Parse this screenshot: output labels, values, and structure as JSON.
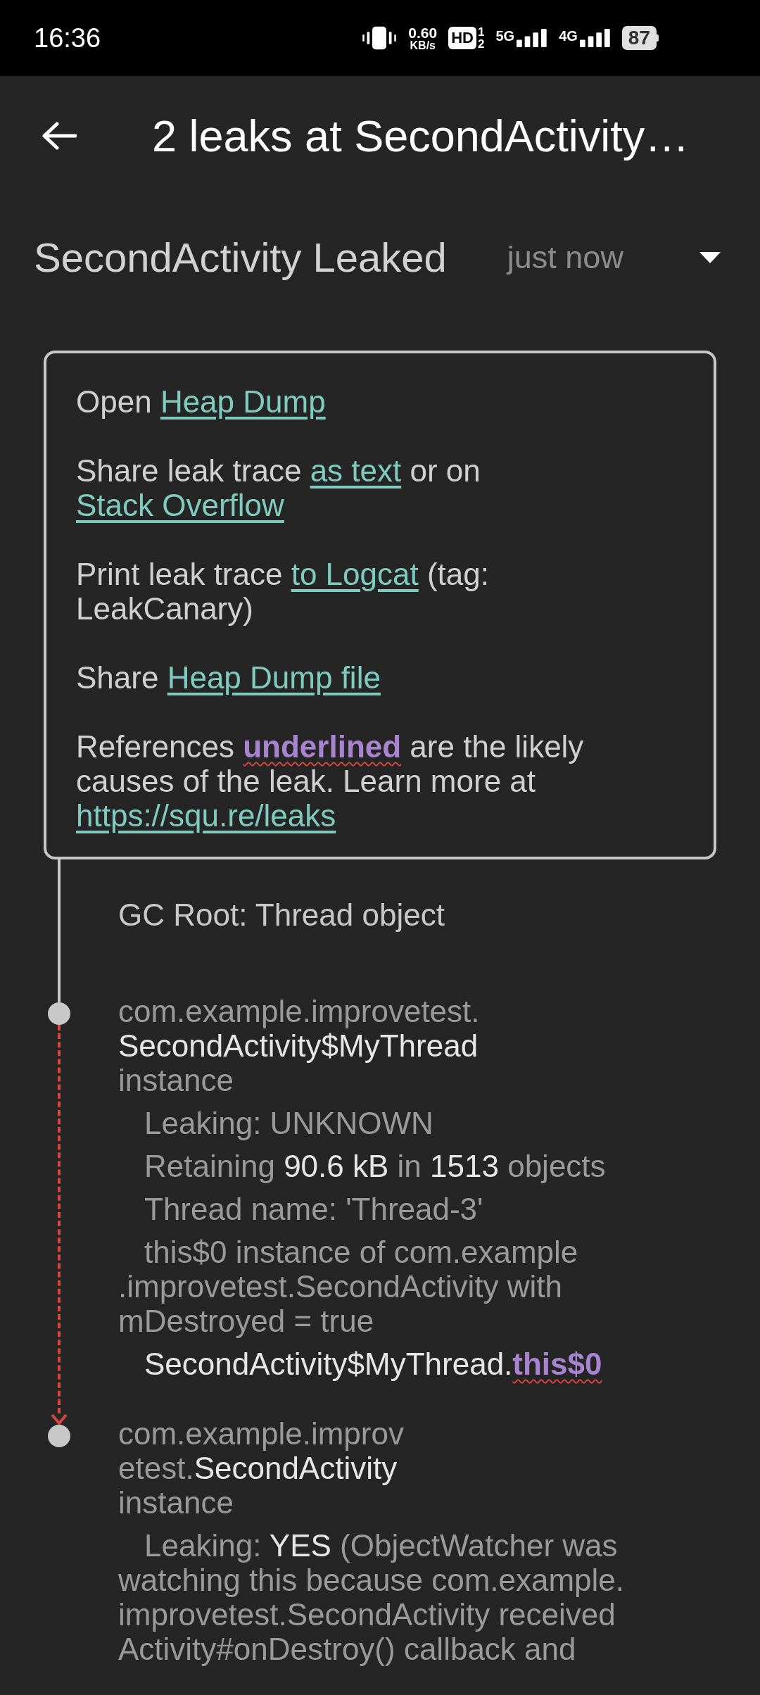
{
  "status_bar": {
    "time": "16:36",
    "speed": "0.60",
    "speed_unit": "KB/s",
    "hd": "HD",
    "sim_1": "1",
    "sim_2": "2",
    "network_1": "5G",
    "network_2": "4G",
    "battery": "87"
  },
  "app_bar": {
    "title": "2 leaks at SecondActivity…"
  },
  "header": {
    "title": "SecondActivity Leaked",
    "time": "just now"
  },
  "info_box": {
    "paragraphs": [
      [
        {
          "text": "Open ",
          "kind": "plain"
        },
        {
          "text": "Heap Dump",
          "kind": "link"
        }
      ],
      [
        {
          "text": "Share leak trace ",
          "kind": "plain"
        },
        {
          "text": "as text",
          "kind": "link"
        },
        {
          "text": " or on ",
          "kind": "plain"
        },
        {
          "text": "Stack Overflow",
          "kind": "link"
        }
      ],
      [
        {
          "text": "Print leak trace ",
          "kind": "plain"
        },
        {
          "text": "to Logcat",
          "kind": "link"
        },
        {
          "text": " (tag: LeakCanary)",
          "kind": "plain"
        }
      ],
      [
        {
          "text": "Share ",
          "kind": "plain"
        },
        {
          "text": "Heap Dump file",
          "kind": "link"
        }
      ],
      [
        {
          "text": "References ",
          "kind": "plain"
        },
        {
          "text": "underlined",
          "kind": "reference"
        },
        {
          "text": " are the likely causes of the leak. Learn more at ",
          "kind": "plain"
        },
        {
          "text": "https://squ.re/leaks",
          "kind": "link"
        }
      ]
    ]
  },
  "trace": {
    "gc_root": "GC Root: Thread object",
    "nodes": [
      {
        "leaking_edge": true,
        "title_lines": [
          [
            {
              "text": "com.example.improvetest.",
              "kind": "dim"
            }
          ],
          [
            {
              "text": "SecondActivity$MyThread",
              "kind": "bright"
            }
          ],
          [
            {
              "text": "instance",
              "kind": "dim"
            }
          ]
        ],
        "details": [
          {
            "lines": [
              [
                {
                  "text": "Leaking: UNKNOWN",
                  "kind": "dim"
                }
              ]
            ]
          },
          {
            "lines": [
              [
                {
                  "text": "Retaining ",
                  "kind": "dim"
                },
                {
                  "text": "90.6 kB",
                  "kind": "bright"
                },
                {
                  "text": " in ",
                  "kind": "dim"
                },
                {
                  "text": "1513",
                  "kind": "bright"
                },
                {
                  "text": " objects",
                  "kind": "dim"
                }
              ]
            ]
          },
          {
            "lines": [
              [
                {
                  "text": "Thread name: 'Thread-3'",
                  "kind": "dim"
                }
              ]
            ]
          },
          {
            "lines": [
              [
                {
                  "text": "this$0 instance of com.example",
                  "kind": "dim"
                }
              ],
              [
                {
                  "text": ".improvetest.SecondActivity with",
                  "kind": "dim"
                }
              ],
              [
                {
                  "text": "mDestroyed = true",
                  "kind": "dim"
                }
              ]
            ]
          },
          {
            "lines": [
              [
                {
                  "text": "SecondActivity$MyThread.",
                  "kind": "bright"
                },
                {
                  "text": "this$0",
                  "kind": "reference"
                }
              ]
            ]
          }
        ]
      },
      {
        "leaking_edge": false,
        "title_lines": [
          [
            {
              "text": "com.example.improv",
              "kind": "dim"
            }
          ],
          [
            {
              "text": "etest.",
              "kind": "dim"
            },
            {
              "text": "SecondActivity",
              "kind": "bright"
            }
          ],
          [
            {
              "text": "instance",
              "kind": "dim"
            }
          ]
        ],
        "details": [
          {
            "lines": [
              [
                {
                  "text": "Leaking: ",
                  "kind": "dim"
                },
                {
                  "text": "YES",
                  "kind": "bright"
                },
                {
                  "text": " (ObjectWatcher was",
                  "kind": "dim"
                }
              ],
              [
                {
                  "text": "watching this because com.example.",
                  "kind": "dim"
                }
              ],
              [
                {
                  "text": "improvetest.SecondActivity received",
                  "kind": "dim"
                }
              ],
              [
                {
                  "text": "Activity#onDestroy() callback and",
                  "kind": "dim"
                }
              ]
            ]
          }
        ]
      }
    ]
  }
}
